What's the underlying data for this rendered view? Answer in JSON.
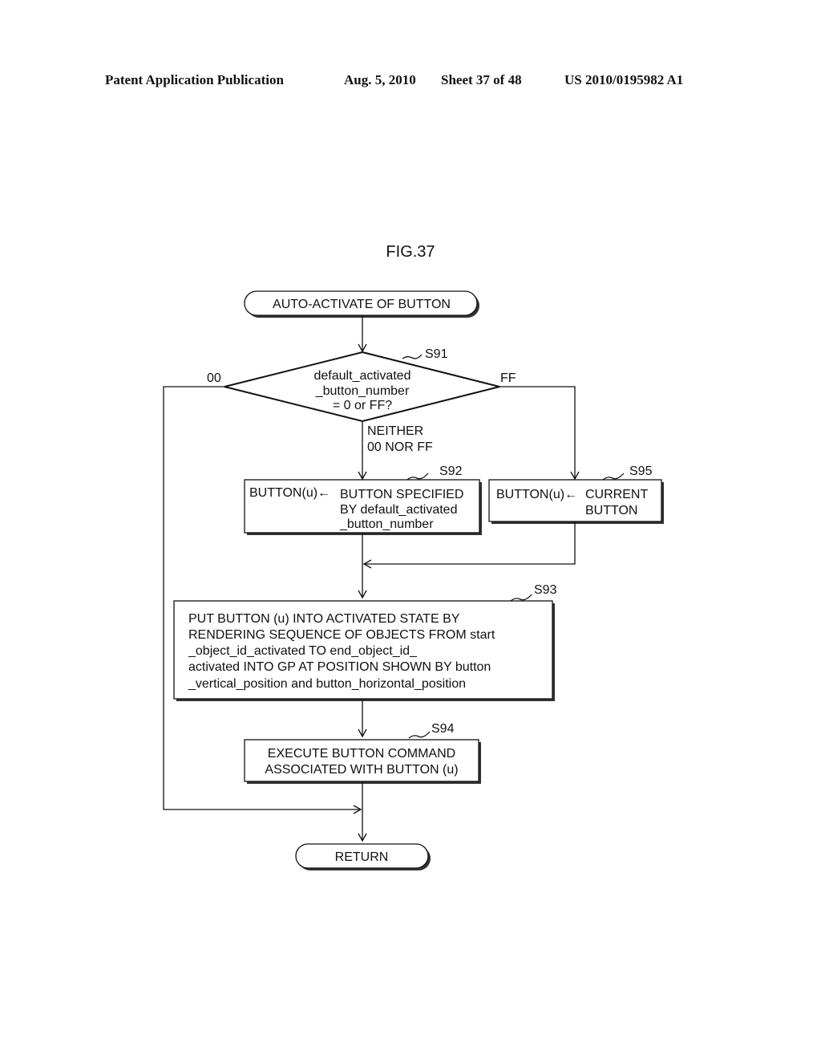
{
  "header": {
    "left": "Patent Application Publication",
    "date": "Aug. 5, 2010",
    "sheet": "Sheet 37 of 48",
    "number": "US 2010/0195982 A1"
  },
  "figure": {
    "title": "FIG.37",
    "start": "AUTO-ACTIVATE OF BUTTON",
    "end": "RETURN",
    "decision": {
      "step": "S91",
      "lines": [
        "default_activated",
        "_button_number",
        "= 0 or FF?"
      ],
      "left_label": "00",
      "right_label": "FF",
      "bottom_label": [
        "NEITHER",
        "00 NOR FF"
      ]
    },
    "s92": {
      "step": "S92",
      "prefix": "BUTTON(u)←",
      "lines": [
        "BUTTON SPECIFIED",
        "BY default_activated",
        "_button_number"
      ]
    },
    "s95": {
      "step": "S95",
      "prefix": "BUTTON(u)←",
      "lines": [
        "CURRENT",
        "BUTTON"
      ]
    },
    "s93": {
      "step": "S93",
      "lines": [
        "PUT BUTTON (u) INTO ACTIVATED STATE BY",
        "RENDERING SEQUENCE OF OBJECTS FROM start",
        "_object_id_activated TO end_object_id_",
        "activated INTO GP AT POSITION SHOWN BY button",
        "_vertical_position and button_horizontal_position"
      ]
    },
    "s94": {
      "step": "S94",
      "lines": [
        "EXECUTE BUTTON COMMAND",
        "ASSOCIATED WITH BUTTON (u)"
      ]
    }
  }
}
